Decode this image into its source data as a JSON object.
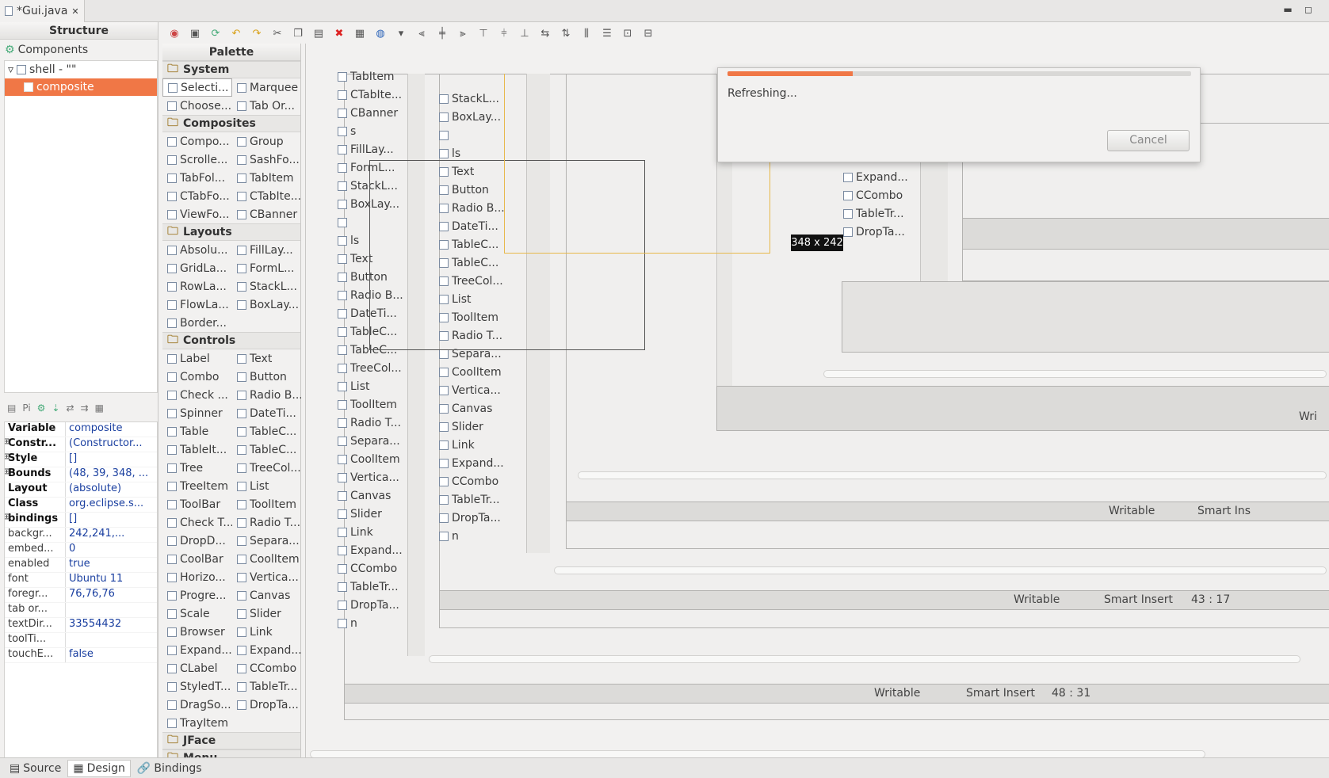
{
  "editor_tab": {
    "title": "*Gui.java",
    "close": "✕"
  },
  "window": {
    "minimize": "▬",
    "maximize": "◻"
  },
  "structure": {
    "title": "Structure",
    "components_label": "Components",
    "tree": [
      {
        "label": "shell - \"\""
      },
      {
        "label": "composite"
      }
    ]
  },
  "properties": {
    "tab_label": "Pi",
    "rows": [
      {
        "name": "Variable",
        "value": "composite",
        "bold": true
      },
      {
        "name": "Constr...",
        "value": "(Constructor...",
        "bold": true,
        "exp": true
      },
      {
        "name": "Style",
        "value": "[]",
        "bold": true,
        "exp": true
      },
      {
        "name": "Bounds",
        "value": "(48, 39, 348, ...",
        "bold": true,
        "exp": true
      },
      {
        "name": "Layout",
        "value": "(absolute)",
        "bold": true
      },
      {
        "name": "Class",
        "value": "org.eclipse.s...",
        "bold": true
      },
      {
        "name": "bindings",
        "value": "[]",
        "bold": true,
        "exp": true
      },
      {
        "name": "backgr...",
        "value": "242,241,..."
      },
      {
        "name": "embed...",
        "value": "0"
      },
      {
        "name": "enabled",
        "value": "true"
      },
      {
        "name": "font",
        "value": "Ubuntu 11"
      },
      {
        "name": "foregr...",
        "value": "76,76,76"
      },
      {
        "name": "tab or...",
        "value": ""
      },
      {
        "name": "textDir...",
        "value": "33554432"
      },
      {
        "name": "toolTi...",
        "value": ""
      },
      {
        "name": "touchE...",
        "value": "false"
      }
    ]
  },
  "palette": {
    "title": "Palette",
    "categories": [
      {
        "name": "System",
        "items": [
          "Selecti...",
          "Marquee",
          "Choose...",
          "Tab Or..."
        ]
      },
      {
        "name": "Composites",
        "items": [
          "Compo...",
          "Group",
          "Scrolle...",
          "SashFo...",
          "TabFol...",
          "TabItem",
          "CTabFo...",
          "CTabIte...",
          "ViewFo...",
          "CBanner"
        ]
      },
      {
        "name": "Layouts",
        "items": [
          "Absolu...",
          "FillLay...",
          "GridLa...",
          "FormL...",
          "RowLa...",
          "StackL...",
          "FlowLa...",
          "BoxLay...",
          "Border..."
        ]
      },
      {
        "name": "Controls",
        "items": [
          "Label",
          "Text",
          "Combo",
          "Button",
          "Check ...",
          "Radio B...",
          "Spinner",
          "DateTi...",
          "Table",
          "TableC...",
          "TableIt...",
          "TableC...",
          "Tree",
          "TreeCol...",
          "TreeItem",
          "List",
          "ToolBar",
          "ToolItem",
          "Check T...",
          "Radio T...",
          "DropD...",
          "Separa...",
          "CoolBar",
          "CoolItem",
          "Horizo...",
          "Vertica...",
          "Progre...",
          "Canvas",
          "Scale",
          "Slider",
          "Browser",
          "Link",
          "Expand...",
          "Expand...",
          "CLabel",
          "CCombo",
          "StyledT...",
          "TableTr...",
          "DragSo...",
          "DropTa...",
          "TrayItem"
        ]
      },
      {
        "name": "JFace",
        "items": []
      },
      {
        "name": "Menu",
        "items": []
      }
    ]
  },
  "canvas": {
    "col1": [
      "TabItem",
      "CTabIte...",
      "CBanner",
      "s",
      "FillLay...",
      "FormL...",
      "StackL...",
      "BoxLay...",
      "",
      "ls",
      "Text",
      "Button",
      "Radio B...",
      "DateTi...",
      "TableC...",
      "TableC...",
      "TreeCol...",
      "List",
      "ToolItem",
      "Radio T...",
      "Separa...",
      "CoolItem",
      "Vertica...",
      "Canvas",
      "Slider",
      "Link",
      "Expand...",
      "CCombo",
      "TableTr...",
      "DropTa...",
      "n"
    ],
    "col2": [
      "StackL...",
      "BoxLay...",
      "",
      "ls",
      "Text",
      "Button",
      "Radio B...",
      "DateTi...",
      "TableC...",
      "TableC...",
      "TreeCol...",
      "List",
      "ToolItem",
      "Radio T...",
      "Separa...",
      "CoolItem",
      "Vertica...",
      "Canvas",
      "Slider",
      "Link",
      "Expand...",
      "CCombo",
      "TableTr...",
      "DropTa...",
      "n"
    ],
    "col3": [
      "Expand...",
      "CCombo",
      "TableTr...",
      "DropTa..."
    ],
    "status_inner": {
      "writable": "Writable",
      "smart": "Smart Ins"
    },
    "status_mid": {
      "writable": "Writable",
      "smart": "Smart Insert",
      "pos": "43 : 17"
    },
    "status_outer": {
      "writable": "Writable",
      "smart": "Smart Insert",
      "pos": "48 : 31"
    },
    "wri": "Wri",
    "dim_label": "348 x 242"
  },
  "dialog": {
    "message": "Refreshing...",
    "cancel": "Cancel",
    "progress": 0.27
  },
  "bottom_tabs": [
    {
      "label": "Source"
    },
    {
      "label": "Design"
    },
    {
      "label": "Bindings"
    }
  ],
  "colors": {
    "accent": "#f07746"
  }
}
